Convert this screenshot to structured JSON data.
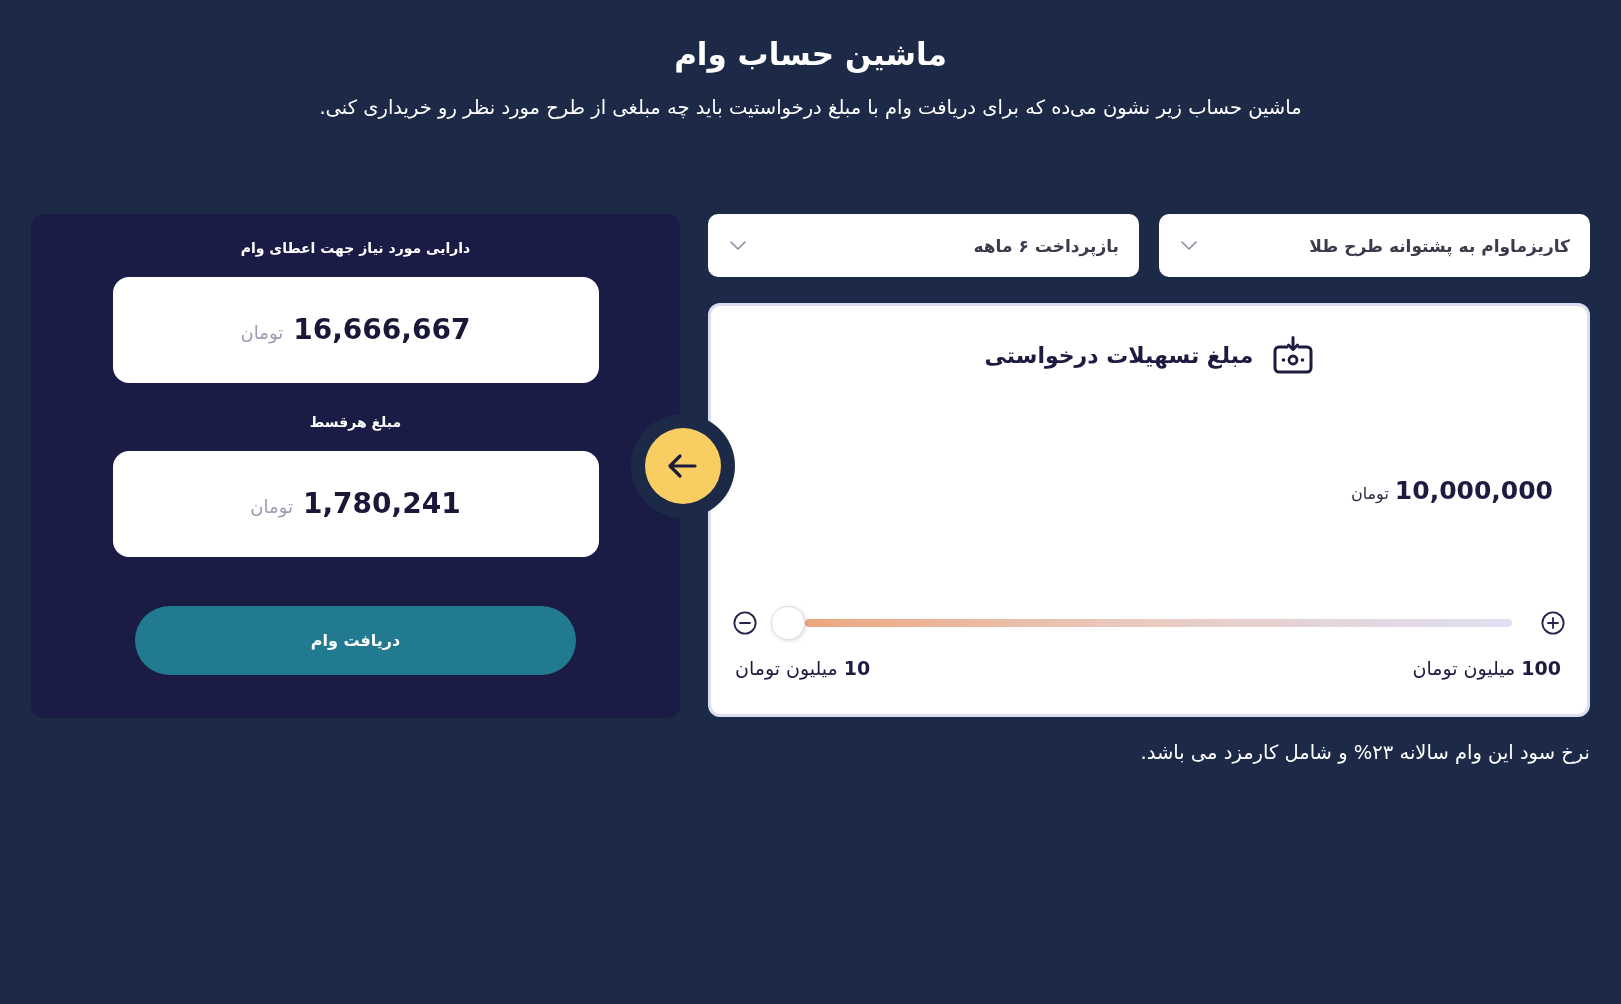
{
  "header": {
    "title": "ماشین حساب وام",
    "subtitle": "ماشین حساب زیر نشون می‌ده که برای دریافت وام با مبلغ درخواستیت باید چه مبلغی از طرح مورد نظر رو خریداری کنی."
  },
  "selects": [
    {
      "value": "کاریزماوام به پشتوانه طرح طلا"
    },
    {
      "value": "بازپرداخت ۶ ماهه"
    }
  ],
  "request_card": {
    "title": "مبلغ تسهیلات درخواستی",
    "amount": "10,000,000",
    "unit": "تومان",
    "slider": {
      "level": 0,
      "min_label": "**10** میلیون تومان",
      "max_label": "**100** میلیون تومان"
    }
  },
  "note": "نرخ سود این وام سالانه ۲۳% و شامل کارمزد می باشد.",
  "results": {
    "items": [
      {
        "label": "دارایی مورد نیاز جهت اعطای وام",
        "amount": "16,666,667",
        "unit": "تومان"
      },
      {
        "label": "مبلغ هرقسط",
        "amount": "1,780,241",
        "unit": "تومان"
      }
    ],
    "button": "دریافت وام"
  }
}
